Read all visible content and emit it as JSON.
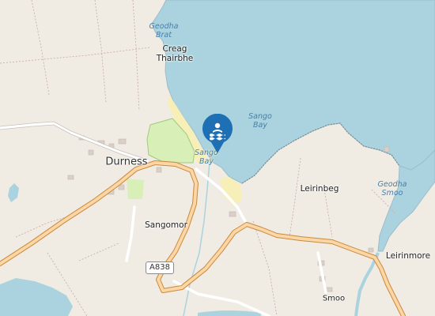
{
  "map": {
    "water_color": "#aad3df",
    "land_color": "#f0ebe3",
    "beach_color": "#f7efb7",
    "road_color": "#f9c98c",
    "marker_color": "#1f6fb4",
    "marker_icon": "swimming-icon",
    "labels": {
      "geodha_brat": "Geodha\nBrat",
      "creag_thairbhe": "Creag\nThairbhe",
      "sango_bay_water": "Sango\nBay",
      "sango_bay_beach": "Sango\nBay",
      "durness": "Durness",
      "sangomor": "Sangomor",
      "leirinbeg": "Leirinbeg",
      "geodha_smoo": "Geodha\nSmoo",
      "leirinmore": "Leirinmore",
      "smoo": "Smoo"
    },
    "road_ref": "A838"
  }
}
